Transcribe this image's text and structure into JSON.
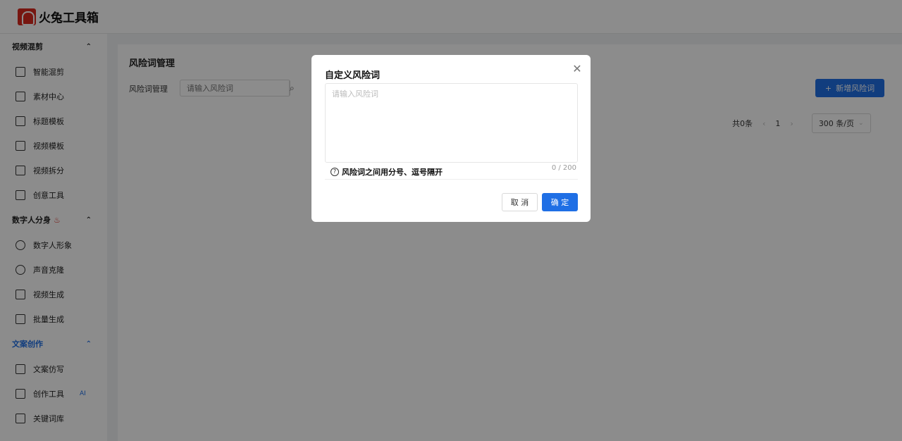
{
  "app": {
    "name": "火兔工具箱"
  },
  "sidebar": {
    "sections": [
      {
        "title": "视频混剪",
        "items": [
          "智能混剪",
          "素材中心",
          "标题模板",
          "视频模板",
          "视频拆分",
          "创意工具"
        ]
      },
      {
        "title": "数字人分身",
        "items": [
          "数字人形象",
          "声音克隆",
          "视频生成",
          "批量生成"
        ]
      },
      {
        "title": "文案创作",
        "items": [
          "文案仿写",
          "创作工具",
          "关键词库"
        ]
      }
    ],
    "ai_tag": "AI"
  },
  "main": {
    "title": "风险词管理",
    "filter_label": "风险词管理",
    "search_placeholder": "请输入风险词",
    "add_button": "新增风险词",
    "pager": {
      "total": "共0条",
      "page": "1",
      "page_size": "300 条/页"
    }
  },
  "modal": {
    "title": "自定义风险词",
    "placeholder": "请输入风险词",
    "hint": "风险词之间用分号、逗号隔开",
    "counter": "0 / 200",
    "cancel": "取 消",
    "ok": "确 定"
  },
  "colors": {
    "accent": "#1f6fe5",
    "brand": "#d9281e"
  }
}
